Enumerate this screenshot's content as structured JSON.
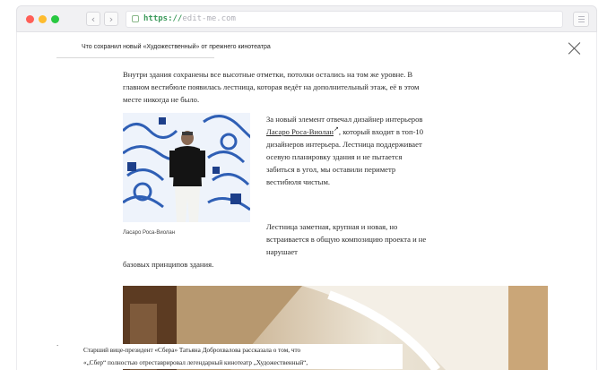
{
  "browser": {
    "dot_colors": [
      "#ff5f57",
      "#febc2e",
      "#28c840"
    ],
    "back_icon": "chevron-left-icon",
    "forward_icon": "chevron-right-icon",
    "url_scheme": "https://",
    "url_host": "edit-me.com",
    "menu_icon": "hamburger-icon"
  },
  "article": {
    "top_title": "Что сохранил новый «Художественный» от прежнего кинотеатра",
    "close_icon": "close-icon",
    "para1": "Внутри здания сохранены все высотные отметки, потолки остались на том же уровне. В главном вестибюле появилась лестница, которая ведёт на дополнительный этаж, её в этом месте никогда не было.",
    "para2_before": "За новый элемент отвечал дизайнер интерьеров ",
    "para2_link": "Ласаро Роса-Виолан",
    "para2_after": ", который входит в топ-10 дизайнеров интерьера. Лестница поддерживает осевую планировку здания и не пытается забиться в угол, мы оставили периметр вестибюля чистым.",
    "para3": "Лестница заметная, крупная и новая, но встраивается в общую композицию проекта и не нарушает",
    "para4": "базовых принципов здания.",
    "photo_caption": "Ласаро Роса-Виолан",
    "bottom_line1": "Старший вице-президент «Сбера» Татьяна Доброхвалова рассказала о том, что",
    "bottom_line2": "«„Сбер“ полностью отреставрировал легендарный кинотеатр „Художественный“,"
  }
}
